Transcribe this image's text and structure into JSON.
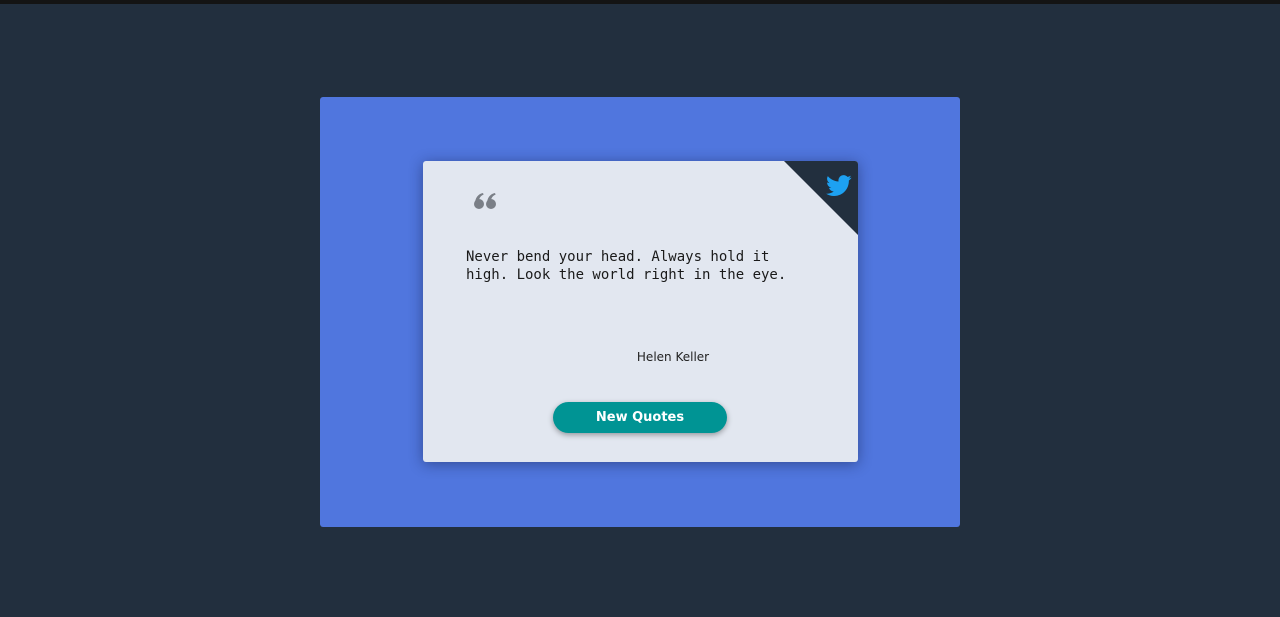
{
  "page": {
    "background_color": "#222f3e",
    "panel_color": "#5076de",
    "card_color": "#e2e7f0"
  },
  "quote_card": {
    "quote_icon": "quote-left-icon",
    "text": "Never bend your head. Always hold it high. Look the world right in the eye.",
    "author": "Helen Keller"
  },
  "share": {
    "icon": "twitter-icon",
    "color": "#1da1f2"
  },
  "actions": {
    "new_quote_label": "New Quotes",
    "button_color": "#009494"
  }
}
